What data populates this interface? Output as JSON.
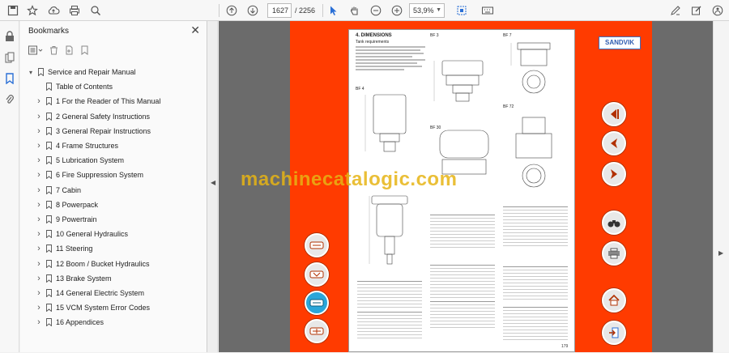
{
  "toolbar": {
    "page_current": "1627",
    "page_total": "/ 2256",
    "zoom": "53,9%",
    "icons": [
      "save-icon",
      "star-icon",
      "upload-icon",
      "print-icon",
      "search-icon",
      "prev-page-icon",
      "next-page-icon",
      "select-icon",
      "hand-icon",
      "zoom-out-icon",
      "zoom-in-icon",
      "fit-icon",
      "keyboard-icon",
      "pen-sign-icon",
      "edit-icon",
      "share-icon"
    ]
  },
  "sidebar": {
    "title": "Bookmarks",
    "items": [
      {
        "label": "Service and Repair Manual",
        "level": 0,
        "expanded": true
      },
      {
        "label": "Table of Contents",
        "level": 1,
        "expandable": false
      },
      {
        "label": "1 For the Reader of This Manual",
        "level": 1,
        "expandable": true
      },
      {
        "label": "2 General Safety Instructions",
        "level": 1,
        "expandable": true
      },
      {
        "label": "3 General Repair Instructions",
        "level": 1,
        "expandable": true
      },
      {
        "label": "4 Frame Structures",
        "level": 1,
        "expandable": true
      },
      {
        "label": "5 Lubrication System",
        "level": 1,
        "expandable": true
      },
      {
        "label": "6 Fire Suppression System",
        "level": 1,
        "expandable": true
      },
      {
        "label": "7 Cabin",
        "level": 1,
        "expandable": true
      },
      {
        "label": "8 Powerpack",
        "level": 1,
        "expandable": true
      },
      {
        "label": "9 Powertrain",
        "level": 1,
        "expandable": true
      },
      {
        "label": "10 General Hydraulics",
        "level": 1,
        "expandable": true
      },
      {
        "label": "11 Steering",
        "level": 1,
        "expandable": true
      },
      {
        "label": "12 Boom / Bucket Hydraulics",
        "level": 1,
        "expandable": true
      },
      {
        "label": "13 Brake System",
        "level": 1,
        "expandable": true
      },
      {
        "label": "14 General Electric System",
        "level": 1,
        "expandable": true
      },
      {
        "label": "15 VCM System Error Codes",
        "level": 1,
        "expandable": true
      },
      {
        "label": "16 Appendices",
        "level": 1,
        "expandable": true
      }
    ]
  },
  "document": {
    "logo": "SANDVIK",
    "watermark": "machinecatalogic.com",
    "section_title": "4. DIMENSIONS",
    "subtitle": "Tank requirements",
    "labels": [
      "BF 3",
      "BF 7",
      "BF 4",
      "BF 30",
      "BF 72"
    ],
    "page_number": "179",
    "accent": "#ff3b00"
  }
}
